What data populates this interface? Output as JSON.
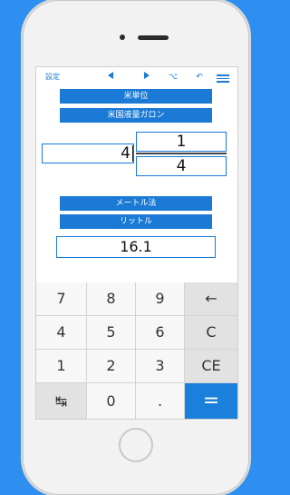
{
  "toolbar": {
    "settings_label": "設定",
    "prev_glyph": "◀",
    "next_glyph": "▶",
    "swap_glyph": "⌥",
    "undo_glyph": "↶",
    "menu_icon": "menu-icon"
  },
  "source": {
    "system": "米単位",
    "unit": "米国液量ガロン",
    "whole": "4",
    "numerator": "1",
    "denominator": "4"
  },
  "destination": {
    "system": "メートル法",
    "unit": "リットル",
    "result": "16.1"
  },
  "keypad": {
    "k7": "7",
    "k8": "8",
    "k9": "9",
    "backspace": "←",
    "k4": "4",
    "k5": "5",
    "k6": "6",
    "clear": "C",
    "k1": "1",
    "k2": "2",
    "k3": "3",
    "clear_entry": "CE",
    "fraction": "↹",
    "k0": "0",
    "decimal": ".",
    "equals": "="
  },
  "colors": {
    "background": "#2f8ff0",
    "accent": "#1a7ad6",
    "equals_key": "#1b7fdc"
  }
}
